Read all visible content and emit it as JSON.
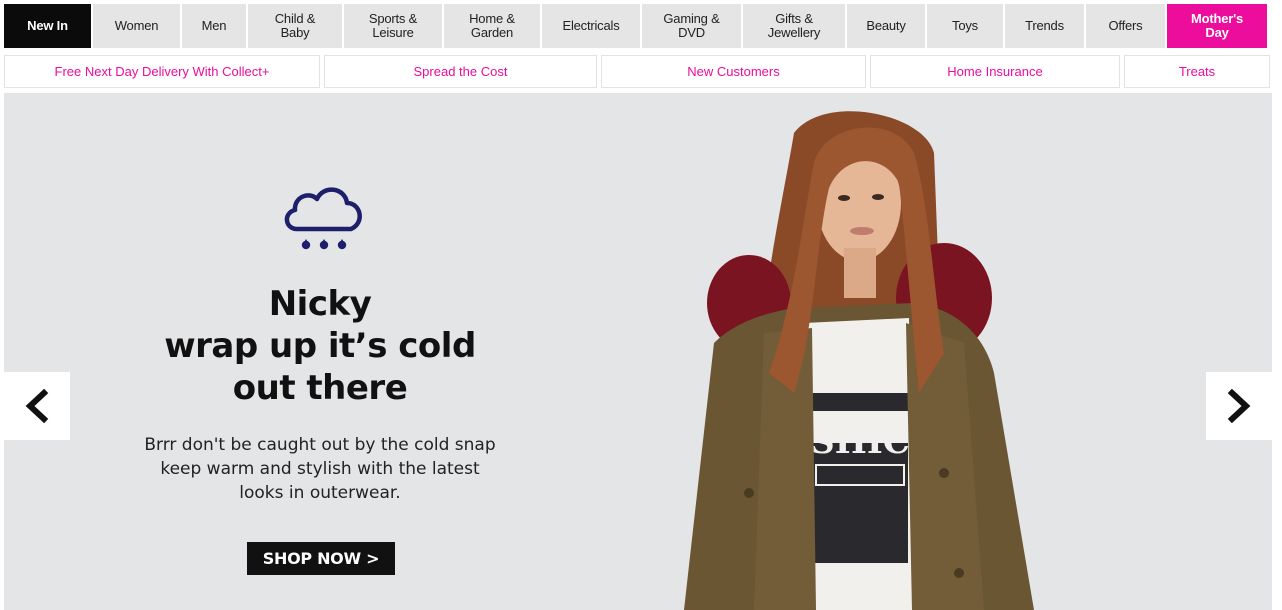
{
  "nav": {
    "categories": [
      {
        "label": "New In"
      },
      {
        "label": "Women"
      },
      {
        "label": "Men"
      },
      {
        "label": "Child &\nBaby"
      },
      {
        "label": "Sports &\nLeisure"
      },
      {
        "label": "Home &\nGarden"
      },
      {
        "label": "Electricals"
      },
      {
        "label": "Gaming &\nDVD"
      },
      {
        "label": "Gifts &\nJewellery"
      },
      {
        "label": "Beauty"
      },
      {
        "label": "Toys"
      },
      {
        "label": "Trends"
      },
      {
        "label": "Offers"
      },
      {
        "label": "Mother's\nDay"
      }
    ]
  },
  "promos": [
    {
      "label": "Free Next Day Delivery With Collect+"
    },
    {
      "label": "Spread the Cost"
    },
    {
      "label": "New Customers"
    },
    {
      "label": "Home Insurance"
    },
    {
      "label": "Treats"
    }
  ],
  "hero": {
    "icon": "rain-cloud-icon",
    "heading_lines": [
      "Nicky",
      "wrap up it’s cold",
      "out there"
    ],
    "desc_lines": [
      "Brrr don't be caught out by the cold snap",
      "keep warm and stylish with the latest",
      "looks in outerwear."
    ],
    "cta": "SHOP NOW >",
    "prev_icon": "chevron-left-icon",
    "next_icon": "chevron-right-icon"
  },
  "colors": {
    "brand_pink": "#ec0d9c",
    "nav_active": "#0b0b0b",
    "nav_bg": "#e5e5e5",
    "hero_bg": "#e4e5e7",
    "icon_navy": "#1d1f6b"
  }
}
